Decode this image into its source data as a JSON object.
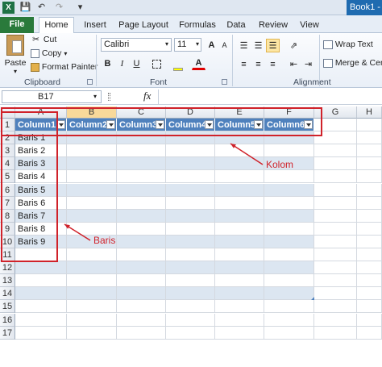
{
  "window": {
    "title": "Book1 -"
  },
  "tabs": [
    "File",
    "Home",
    "Insert",
    "Page Layout",
    "Formulas",
    "Data",
    "Review",
    "View"
  ],
  "clipboard": {
    "paste": "Paste",
    "cut": "Cut",
    "copy": "Copy",
    "format_painter": "Format Painter",
    "group": "Clipboard"
  },
  "font": {
    "name": "Calibri",
    "size": "11",
    "group": "Font",
    "bold": "B",
    "italic": "I",
    "underline": "U",
    "grow": "A",
    "shrink": "A"
  },
  "alignment": {
    "wrap": "Wrap Text",
    "merge": "Merge & Cent",
    "group": "Alignment"
  },
  "formula_bar": {
    "name_box": "B17",
    "fx": "fx",
    "value": ""
  },
  "columns": [
    "A",
    "B",
    "C",
    "D",
    "E",
    "F",
    "G",
    "H"
  ],
  "rows": [
    "1",
    "2",
    "3",
    "4",
    "5",
    "6",
    "7",
    "8",
    "9",
    "10",
    "11",
    "12",
    "13",
    "14",
    "15",
    "16",
    "17"
  ],
  "table": {
    "headers": [
      "Column1",
      "Column2",
      "Column3",
      "Column4",
      "Column5",
      "Column6"
    ],
    "col_a": [
      "Baris 1",
      "Baris 2",
      "Baris 3",
      "Baris 4",
      "Baris 5",
      "Baris 6",
      "Baris 7",
      "Baris 8",
      "Baris 9",
      "",
      ""
    ]
  },
  "annotations": {
    "kolom": "Kolom",
    "baris": "Baris",
    "color": "#d0222a"
  }
}
